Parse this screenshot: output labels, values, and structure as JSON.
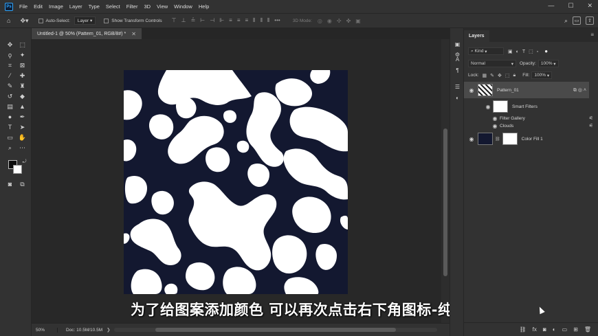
{
  "menubar": {
    "logo": "Ps",
    "items": [
      "File",
      "Edit",
      "Image",
      "Layer",
      "Type",
      "Select",
      "Filter",
      "3D",
      "View",
      "Window",
      "Help"
    ],
    "window_controls": [
      "—",
      "☐",
      "✕"
    ]
  },
  "options_bar": {
    "auto_select_label": "Auto-Select:",
    "auto_select_value": "Layer",
    "transform_label": "Show Transform Controls",
    "mode_3d_label": "3D Mode:"
  },
  "document": {
    "tab_title": "Untitled-1 @ 50% (Pattern_01, RGB/8#) *",
    "zoom": "50%",
    "doc_size": "Doc: 10.5M/10.5M",
    "canvas_color": "#131830"
  },
  "subtitle": "为了给图案添加颜色 可以再次点击右下角图标-纯色",
  "layers_panel": {
    "tab_label": "Layers",
    "filter_kind": "Kind",
    "blend_mode": "Normal",
    "opacity_label": "Opacity:",
    "opacity_value": "100%",
    "lock_label": "Lock:",
    "fill_label": "Fill:",
    "fill_value": "100%",
    "layers": [
      {
        "name": "Pattern_01"
      },
      {
        "name": "Smart Filters"
      },
      {
        "name": "Filter Gallery"
      },
      {
        "name": "Clouds"
      },
      {
        "name": "Color Fill 1"
      }
    ]
  }
}
